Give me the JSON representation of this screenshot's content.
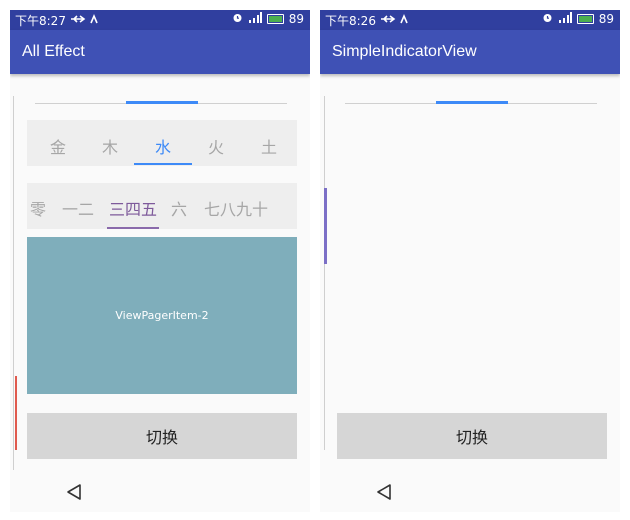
{
  "left": {
    "status": {
      "time": "下午8:27",
      "battery": "89"
    },
    "app_title": "All Effect",
    "tabs_row1": [
      "金",
      "木",
      "水",
      "火",
      "土"
    ],
    "tabs_row1_selected": 2,
    "tabs_row2": [
      "零",
      "一二",
      "三四五",
      "六",
      "七八九十"
    ],
    "tabs_row2_selected": 2,
    "pager_item": "ViewPagerItem-2",
    "switch_button": "切换"
  },
  "right": {
    "status": {
      "time": "下午8:26",
      "battery": "89"
    },
    "app_title": "SimpleIndicatorView",
    "switch_button": "切换"
  },
  "colors": {
    "primary": "#3f51b5",
    "primary_dark": "#303f9f",
    "indicator_blue": "#3d8af7",
    "indicator_purple": "#8a6aab",
    "indicator_red": "#e05a4e",
    "pager_bg": "#7faebb"
  }
}
